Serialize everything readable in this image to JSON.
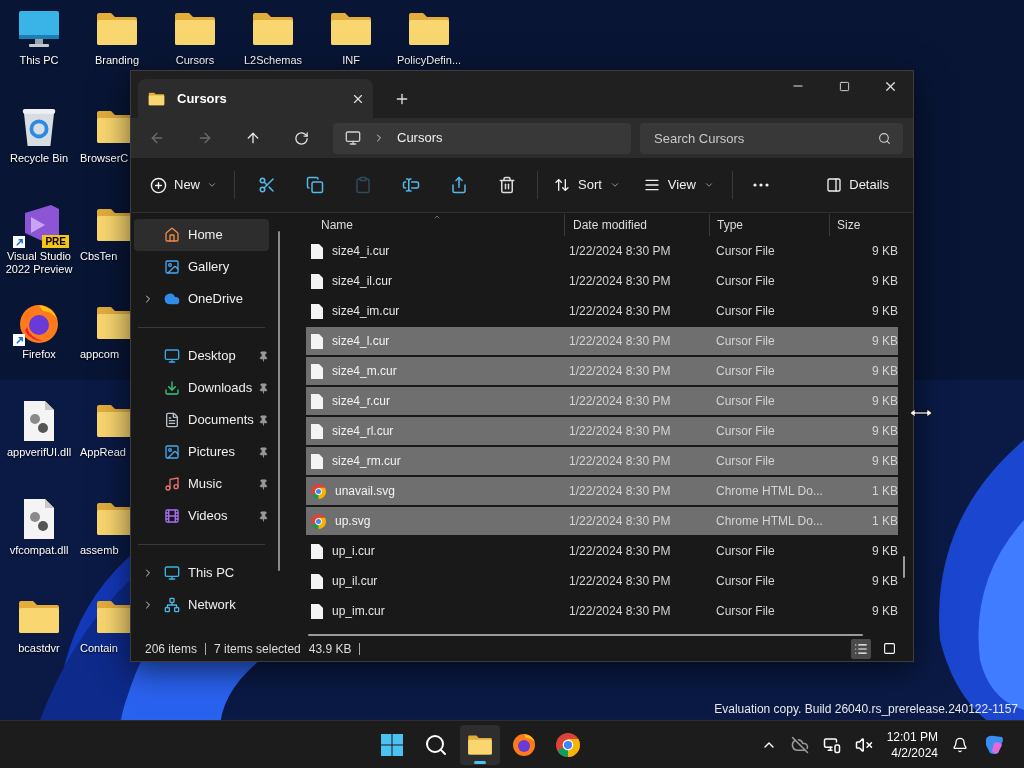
{
  "desktop": {
    "columns": [
      [
        {
          "label": "This PC",
          "kind": "pc",
          "shortcut": false
        },
        {
          "label": "Recycle Bin",
          "kind": "recycle",
          "shortcut": false
        },
        {
          "label": "Visual Studio 2022 Preview",
          "kind": "ide",
          "shortcut": true,
          "badge": "PRE"
        },
        {
          "label": "Firefox",
          "kind": "browser",
          "shortcut": true
        },
        {
          "label": "appverifUI.dll",
          "kind": "dll",
          "shortcut": false
        },
        {
          "label": "vfcompat.dll",
          "kind": "dll",
          "shortcut": false
        },
        {
          "label": "bcastdvr",
          "kind": "folder",
          "shortcut": false
        }
      ],
      [
        {
          "label": "Branding",
          "kind": "folder",
          "shortcut": false
        },
        {
          "label": "BrowserC",
          "kind": "folder",
          "shortcut": false
        },
        {
          "label": "CbsTen",
          "kind": "folder",
          "shortcut": false
        },
        {
          "label": "appcom",
          "kind": "folder",
          "shortcut": false
        },
        {
          "label": "AppRead",
          "kind": "folder",
          "shortcut": false
        },
        {
          "label": "assemb",
          "kind": "folder",
          "shortcut": false
        },
        {
          "label": "Contain",
          "kind": "folder",
          "shortcut": false
        }
      ],
      [
        {
          "label": "Cursors",
          "kind": "folder",
          "shortcut": false
        }
      ],
      [
        {
          "label": "L2Schemas",
          "kind": "folder",
          "shortcut": false
        }
      ],
      [
        {
          "label": "INF",
          "kind": "folder",
          "shortcut": false
        }
      ],
      [
        {
          "label": "PolicyDefin...",
          "kind": "folder",
          "shortcut": false
        }
      ]
    ],
    "watermark": "Evaluation copy. Build 26040.rs_prerelease.240122-1157"
  },
  "window": {
    "tab_title": "Cursors",
    "breadcrumb": "Cursors",
    "search": {
      "placeholder": "Search Cursors"
    }
  },
  "toolbar": {
    "new_label": "New",
    "icon_buttons": [
      {
        "disabled": false
      },
      {
        "disabled": false
      },
      {
        "disabled": true
      },
      {
        "disabled": false
      },
      {
        "disabled": false
      },
      {
        "disabled": false
      }
    ],
    "sort_label": "Sort",
    "view_label": "View",
    "details_label": "Details"
  },
  "sidebar": {
    "groups": [
      [
        {
          "label": "Home",
          "kind": "home",
          "selected": true,
          "pinned": false,
          "expandable": false
        },
        {
          "label": "Gallery",
          "kind": "gallery",
          "selected": false,
          "pinned": false,
          "expandable": false
        },
        {
          "label": "OneDrive",
          "kind": "cloud",
          "selected": false,
          "pinned": false,
          "expandable": true
        }
      ],
      [
        {
          "label": "Desktop",
          "kind": "desktop",
          "selected": false,
          "pinned": true,
          "expandable": false
        },
        {
          "label": "Downloads",
          "kind": "downloads",
          "selected": false,
          "pinned": true,
          "expandable": false
        },
        {
          "label": "Documents",
          "kind": "documents",
          "selected": false,
          "pinned": true,
          "expandable": false
        },
        {
          "label": "Pictures",
          "kind": "pictures",
          "selected": false,
          "pinned": true,
          "expandable": false
        },
        {
          "label": "Music",
          "kind": "music",
          "selected": false,
          "pinned": true,
          "expandable": false
        },
        {
          "label": "Videos",
          "kind": "videos",
          "selected": false,
          "pinned": true,
          "expandable": false
        }
      ],
      [
        {
          "label": "This PC",
          "kind": "pc",
          "selected": false,
          "pinned": false,
          "expandable": true
        },
        {
          "label": "Network",
          "kind": "network",
          "selected": false,
          "pinned": false,
          "expandable": true
        }
      ]
    ]
  },
  "files": {
    "columns": [
      "Name",
      "Date modified",
      "Type",
      "Size"
    ],
    "rows": [
      {
        "name": "size4_i.cur",
        "date": "1/22/2024 8:30 PM",
        "type": "Cursor File",
        "size": "9 KB",
        "kind": "file",
        "selected": false
      },
      {
        "name": "size4_il.cur",
        "date": "1/22/2024 8:30 PM",
        "type": "Cursor File",
        "size": "9 KB",
        "kind": "file",
        "selected": false
      },
      {
        "name": "size4_im.cur",
        "date": "1/22/2024 8:30 PM",
        "type": "Cursor File",
        "size": "9 KB",
        "kind": "file",
        "selected": false
      },
      {
        "name": "size4_l.cur",
        "date": "1/22/2024 8:30 PM",
        "type": "Cursor File",
        "size": "9 KB",
        "kind": "file",
        "selected": true
      },
      {
        "name": "size4_m.cur",
        "date": "1/22/2024 8:30 PM",
        "type": "Cursor File",
        "size": "9 KB",
        "kind": "file",
        "selected": true
      },
      {
        "name": "size4_r.cur",
        "date": "1/22/2024 8:30 PM",
        "type": "Cursor File",
        "size": "9 KB",
        "kind": "file",
        "selected": true
      },
      {
        "name": "size4_rl.cur",
        "date": "1/22/2024 8:30 PM",
        "type": "Cursor File",
        "size": "9 KB",
        "kind": "file",
        "selected": true
      },
      {
        "name": "size4_rm.cur",
        "date": "1/22/2024 8:30 PM",
        "type": "Cursor File",
        "size": "9 KB",
        "kind": "file",
        "selected": true
      },
      {
        "name": "unavail.svg",
        "date": "1/22/2024 8:30 PM",
        "type": "Chrome HTML Do...",
        "size": "1 KB",
        "kind": "web",
        "selected": true
      },
      {
        "name": "up.svg",
        "date": "1/22/2024 8:30 PM",
        "type": "Chrome HTML Do...",
        "size": "1 KB",
        "kind": "web",
        "selected": true
      },
      {
        "name": "up_i.cur",
        "date": "1/22/2024 8:30 PM",
        "type": "Cursor File",
        "size": "9 KB",
        "kind": "file",
        "selected": false
      },
      {
        "name": "up_il.cur",
        "date": "1/22/2024 8:30 PM",
        "type": "Cursor File",
        "size": "9 KB",
        "kind": "file",
        "selected": false
      },
      {
        "name": "up_im.cur",
        "date": "1/22/2024 8:30 PM",
        "type": "Cursor File",
        "size": "9 KB",
        "kind": "file",
        "selected": false
      }
    ]
  },
  "status": {
    "count": "206 items",
    "selection": "7 items selected",
    "size": "43.9 KB",
    "views": [
      {
        "selected": true
      },
      {
        "selected": false
      }
    ]
  },
  "taskbar": {
    "apps": [
      {
        "active": false
      },
      {
        "active": false
      },
      {
        "active": true
      },
      {
        "active": false
      },
      {
        "active": false
      }
    ],
    "time": "12:01 PM",
    "date": "4/2/2024"
  }
}
